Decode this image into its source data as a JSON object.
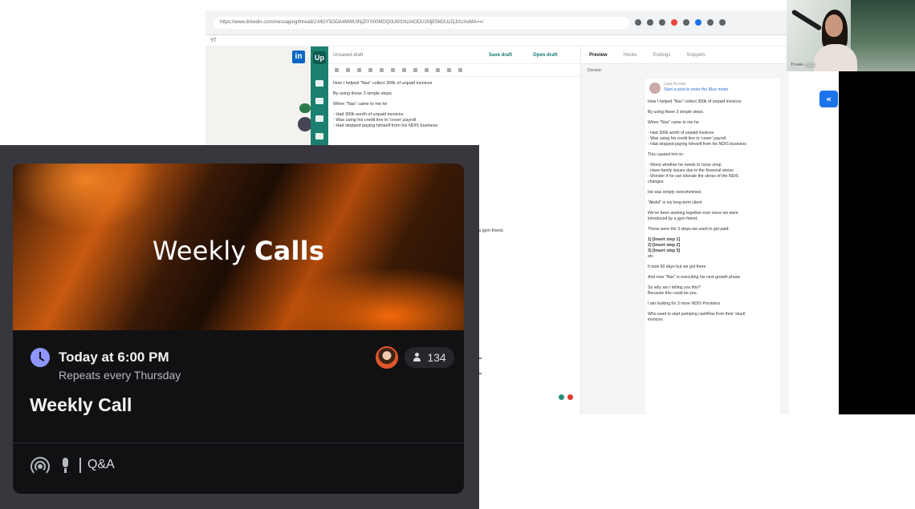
{
  "browser": {
    "url": "https://www.linkedin.com/messaging/thread/2-MGY5ODA4MWUtNjZlYS00MDQ0LWI1NzAtODU2MjE5M2UzZjJlXzAxMA==/",
    "bookmark": "YT"
  },
  "editor": {
    "draft_label": "Unsaved draft",
    "save_label": "Save draft",
    "open_label": "Open draft",
    "lines": [
      "How I helped \"Nas\" collect 300k of unpaid invoices",
      "By using these 3 simple steps.",
      "When \"Nas\" came to me he",
      "- Had 300k worth of unpaid invoices",
      "- Was using his credit line to 'cover' payroll",
      "- Had stopped paying himself from his NDIS business"
    ],
    "extra_line": "a gym friend."
  },
  "preview": {
    "tabs": [
      "Preview",
      "Hooks",
      "Endings",
      "Snippets"
    ],
    "device_label": "Device:",
    "author_name": "Lara Acosta",
    "author_sub": "Start a post to enter the Blue mode",
    "lines": [
      "How I helped \"Nas\" collect 300k of unpaid invoices",
      "By using these 3 simple steps.",
      "When \"Nas\" came to me he",
      "- Had 300k worth of unpaid invoices",
      "- Was using his credit line to 'cover' payroll",
      "- Had stopped paying himself from his NDIS business",
      "This caused him to:",
      "- Worry whether he needs to close shop",
      "- Have family issues due to the financial stress",
      "- Wonder if he can tolerate the stress of the NDIS",
      "changes",
      "He was simply overwhelmed.",
      "\"Abdul\" is my long-term client",
      "We've been working together ever since we were",
      "introduced by a gym friend.",
      "These were the 3 steps we used to get paid:",
      "1) [Insert step 1]",
      "2) [Insert step 2]",
      "3) [Insert step 3]",
      "etc",
      "It took 60 days but we got there",
      "And now \"Nas\" is executing his next growth phase",
      "So why am I telling you this?",
      "Because this could be you.",
      "I am looking for 3 more NDIS Providers",
      "Who want to start pumping cashflow from their 'stuck'",
      "invoices"
    ]
  },
  "webcam": {
    "name": "Lara Acosta",
    "caption": "Thanks"
  },
  "event": {
    "banner_title_regular": "Weekly",
    "banner_title_bold": "Calls",
    "time": "Today at 6:00 PM",
    "repeat": "Repeats every Thursday",
    "interested_count": "134",
    "title": "Weekly Call",
    "channel": "Q&A",
    "accent_color": "#8e95ff",
    "banner_colors": [
      "#c85a10",
      "#1b0c04"
    ]
  }
}
